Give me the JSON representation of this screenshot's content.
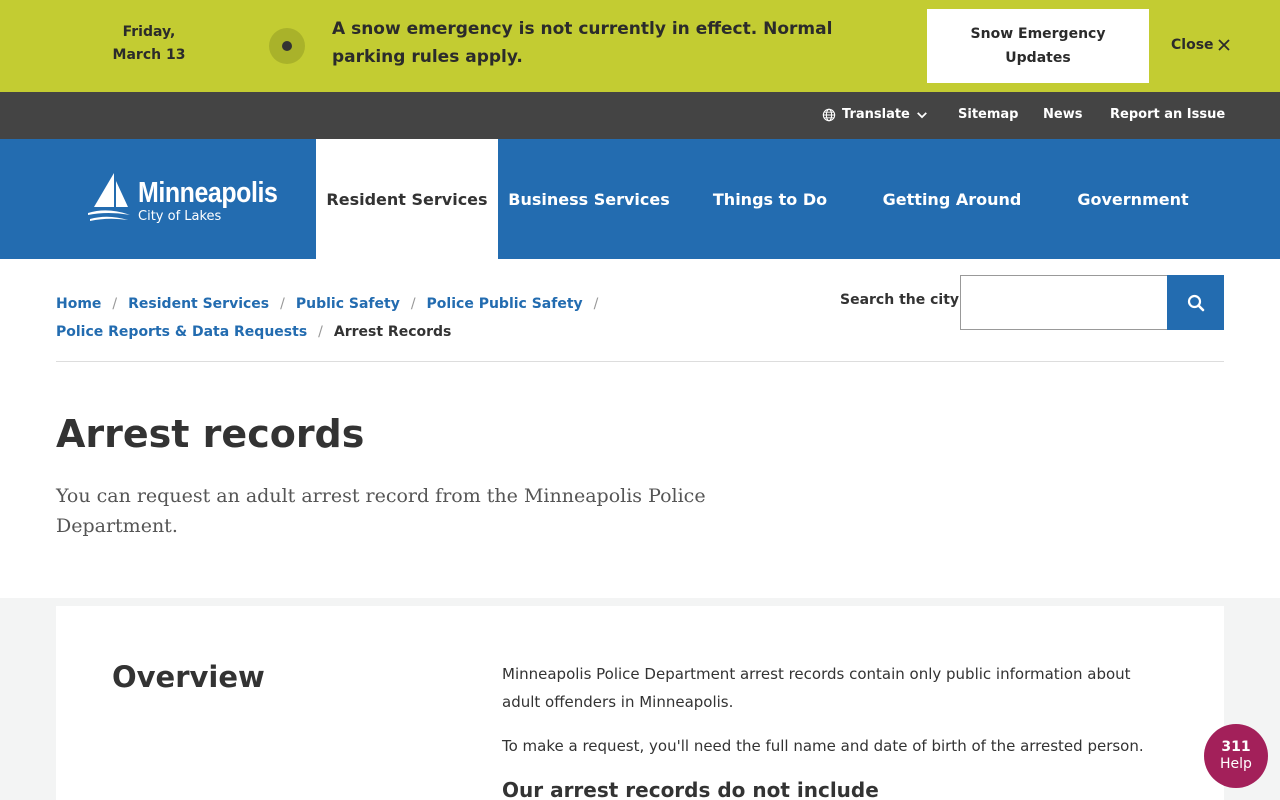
{
  "alert": {
    "date_line1": "Friday,",
    "date_line2": "March 13",
    "message": "A snow emergency is not currently in effect. Normal parking rules apply.",
    "updates_button": "Snow Emergency Updates",
    "close_label": "Close"
  },
  "utility": {
    "translate": "Translate",
    "sitemap": "Sitemap",
    "news": "News",
    "report": "Report an Issue"
  },
  "header": {
    "logo_name": "Minneapolis",
    "logo_tagline": "City of Lakes",
    "nav": [
      {
        "label": "Resident Services",
        "active": true
      },
      {
        "label": "Business Services"
      },
      {
        "label": "Things to Do"
      },
      {
        "label": "Getting Around"
      },
      {
        "label": "Government"
      }
    ]
  },
  "breadcrumb": {
    "items": [
      "Home",
      "Resident Services",
      "Public Safety",
      "Police Public Safety",
      "Police Reports & Data Requests"
    ],
    "current": "Arrest Records",
    "separator": "/"
  },
  "search": {
    "label": "Search the city",
    "value": "",
    "placeholder": ""
  },
  "page": {
    "title": "Arrest records",
    "lede": "You can request an adult arrest record from the Minneapolis Police Department."
  },
  "content": {
    "overview_heading": "Overview",
    "para1": "Minneapolis Police Department arrest records contain only public information about adult offenders in Minneapolis.",
    "para2": "To make a request, you'll need the full name and date of birth of the arrested person.",
    "subheading": "Our arrest records do not include"
  },
  "help": {
    "number": "311",
    "label": "Help"
  },
  "colors": {
    "alert_bg": "#c3cc32",
    "utility_bg": "#444444",
    "brand_blue": "#236cb0",
    "help_bg": "#a3205a"
  },
  "icons": [
    "globe-icon",
    "chevron-down-icon",
    "close-icon",
    "search-icon",
    "sailboat-logo-icon"
  ]
}
